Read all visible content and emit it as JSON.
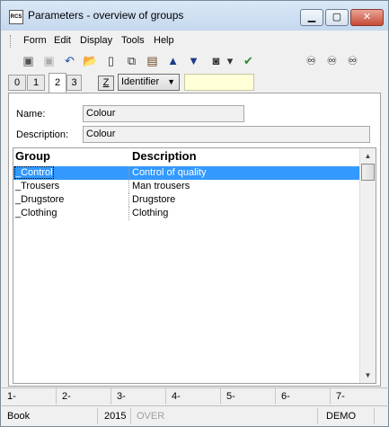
{
  "window": {
    "title": "Parameters - overview of groups",
    "icon_text": "RCS"
  },
  "title_buttons": {
    "minimize": "▁",
    "maximize": "▢",
    "close": "✕"
  },
  "menu": [
    "Form",
    "Edit",
    "Display",
    "Tools",
    "Help"
  ],
  "toolbar": [
    {
      "name": "save-icon",
      "glyph": "▣"
    },
    {
      "name": "save-disabled-icon",
      "glyph": "▣"
    },
    {
      "name": "undo-icon",
      "glyph": "↶"
    },
    {
      "name": "open-folder-icon",
      "glyph": "📂"
    },
    {
      "name": "new-document-icon",
      "glyph": "▯"
    },
    {
      "name": "copy-icon",
      "glyph": "⧉"
    },
    {
      "name": "book-icon",
      "glyph": "▤"
    },
    {
      "name": "arrow-up-icon",
      "glyph": "▲"
    },
    {
      "name": "arrow-down-icon",
      "glyph": "▼"
    },
    {
      "name": "camera-icon",
      "glyph": "◙"
    },
    {
      "name": "dropdown-arrow-icon",
      "glyph": "▾"
    },
    {
      "name": "check-cross-icon",
      "glyph": "✔"
    },
    {
      "name": "binoculars-icon",
      "glyph": "♾"
    },
    {
      "name": "binoculars-prev-icon",
      "glyph": "♾"
    },
    {
      "name": "binoculars-next-icon",
      "glyph": "♾"
    }
  ],
  "tabs": [
    "0",
    "1",
    "2",
    "3"
  ],
  "active_tab": "2",
  "z_button": "Z",
  "sort_combo": {
    "value": "Identifier"
  },
  "form": {
    "name_label": "Name:",
    "name_value": "Colour",
    "description_label": "Description:",
    "description_value": "Colour"
  },
  "grid": {
    "columns": [
      "Group",
      "Description"
    ],
    "rows": [
      {
        "group": "_Control",
        "description": "Control of quality",
        "selected": true
      },
      {
        "group": "_Trousers",
        "description": "Man trousers",
        "selected": false
      },
      {
        "group": "_Drugstore",
        "description": "Drugstore",
        "selected": false
      },
      {
        "group": "_Clothing",
        "description": "Clothing",
        "selected": false
      }
    ]
  },
  "function_keys": [
    "1-",
    "2-",
    "3-",
    "4-",
    "5-",
    "6-",
    "7-"
  ],
  "status": {
    "book": "Book",
    "year": "2015",
    "over": "OVER",
    "mode": "DEMO"
  },
  "colors": {
    "selection": "#3399ff",
    "yellow_field": "#ffffd8",
    "titlebar": "#c4d8ee"
  }
}
